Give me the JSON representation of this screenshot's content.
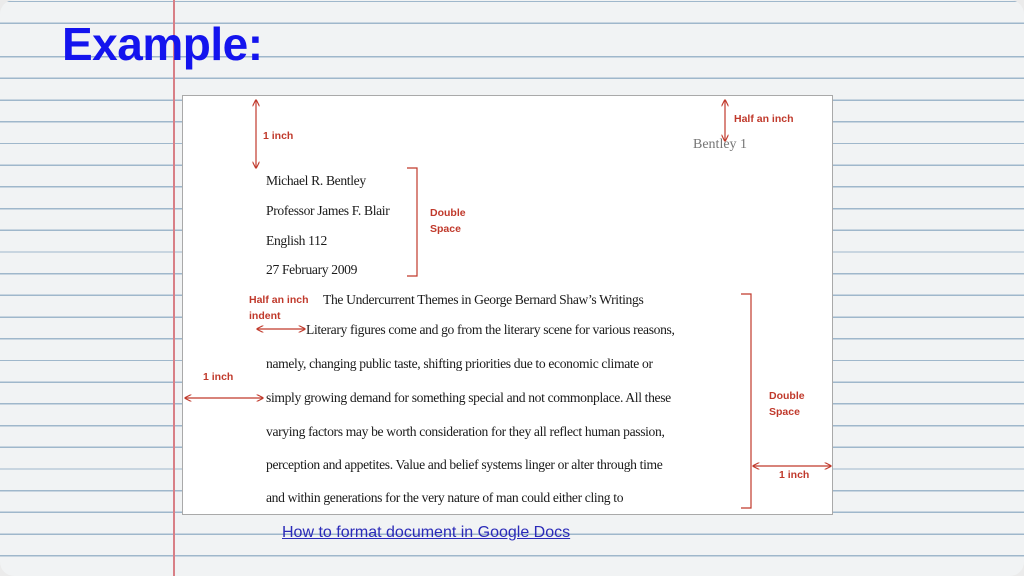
{
  "slide": {
    "title": "Example:"
  },
  "document": {
    "running_header": "Bentley 1",
    "heading_block": [
      "Michael R. Bentley",
      "Professor James F. Blair",
      "English 112",
      "27 February 2009"
    ],
    "essay_title": "The Undercurrent Themes in George Bernard Shaw’s Writings",
    "body_lines": [
      "Literary figures come and go from the literary scene for various reasons,",
      "namely, changing public taste, shifting priorities due to economic climate or",
      "simply growing demand for something special and not commonplace. All these",
      "varying factors may be worth consideration for they all reflect human passion,",
      "perception and appetites. Value and belief systems linger or alter through time",
      "and within generations for the very nature of man could either cling to"
    ]
  },
  "annotations": {
    "top_margin": "1 inch",
    "header_offset": "Half an inch",
    "double_space_top": [
      "Double",
      "Space"
    ],
    "indent": [
      "Half an inch",
      "indent"
    ],
    "left_margin": "1 inch",
    "double_space_body": [
      "Double",
      "Space"
    ],
    "right_margin": "1 inch"
  },
  "colors": {
    "title": "#1414ee",
    "annotation": "#c0392b",
    "margin_line": "#d87f86",
    "ruled_line": "#9fb7cb"
  },
  "link": {
    "text": "How to format document in Google Docs"
  }
}
